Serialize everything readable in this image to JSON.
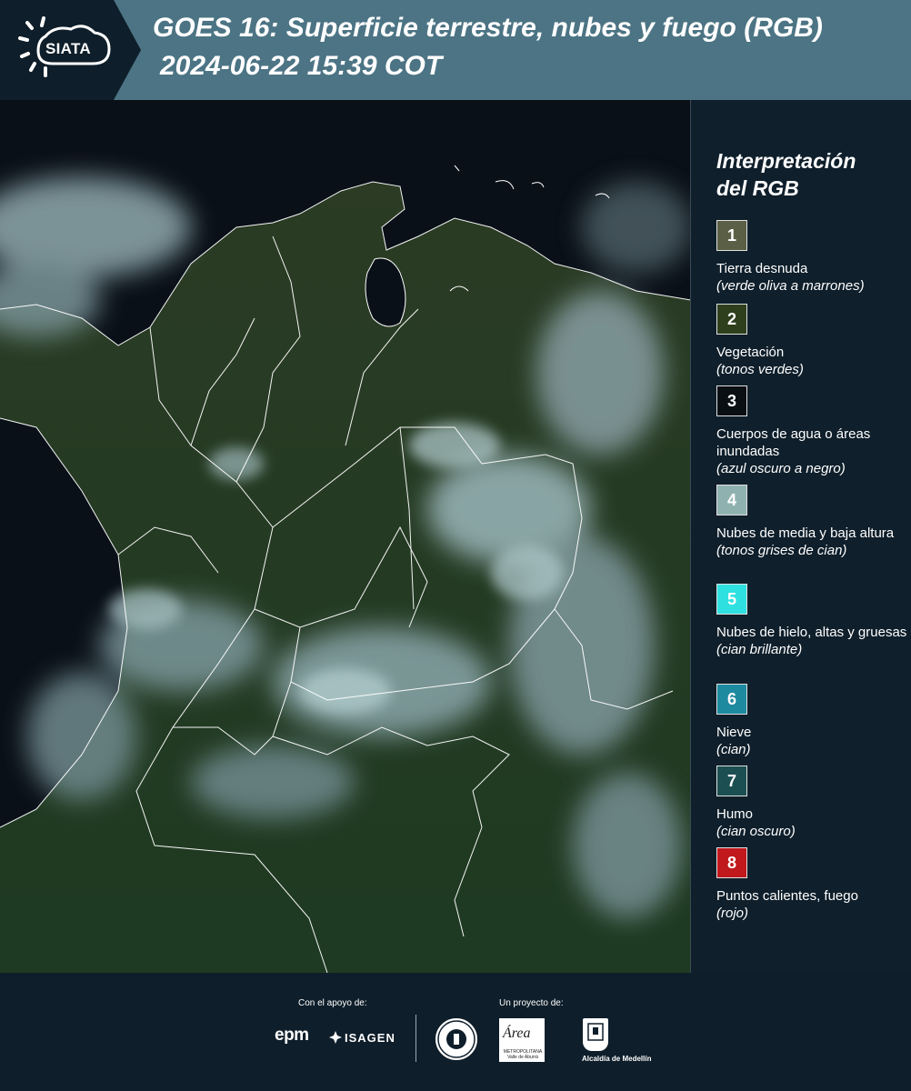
{
  "header": {
    "logo_text": "SIATA",
    "title_line1": "GOES 16: Superficie terrestre, nubes y fuego (RGB)",
    "title_line2": "2024-06-22 15:39 COT"
  },
  "legend": {
    "title_line1": "Interpretación",
    "title_line2": "del RGB",
    "items": [
      {
        "number": "1",
        "color": "#5b5f45",
        "label": "Tierra desnuda",
        "sub": "(verde oliva a marrones)"
      },
      {
        "number": "2",
        "color": "#2e3f1d",
        "label": "Vegetación",
        "sub": "(tonos verdes)"
      },
      {
        "number": "3",
        "color": "#0a0f14",
        "label": "Cuerpos de agua o áreas inundadas",
        "sub": "(azul oscuro a negro)"
      },
      {
        "number": "4",
        "color": "#8fb2b0",
        "label": "Nubes de media y baja altura",
        "sub": "(tonos grises de cian)"
      },
      {
        "number": "5",
        "color": "#2fe0e0",
        "label": "Nubes de hielo, altas y gruesas",
        "sub": "(cian brillante)"
      },
      {
        "number": "6",
        "color": "#1e8aa0",
        "label": "Nieve",
        "sub": "(cian)"
      },
      {
        "number": "7",
        "color": "#1c4f52",
        "label": "Humo",
        "sub": "(cian oscuro)"
      },
      {
        "number": "8",
        "color": "#c0181c",
        "label": "Puntos calientes, fuego",
        "sub": "(rojo)"
      }
    ]
  },
  "footer": {
    "support_label": "Con el apoyo de:",
    "project_label": "Un proyecto de:",
    "epm": "epm",
    "isagen": "ISAGEN",
    "area_logo": "Área",
    "area_sub": "METROPOLITANA Valle de Aburrá",
    "alcaldia": "Alcaldía de Medellín"
  }
}
